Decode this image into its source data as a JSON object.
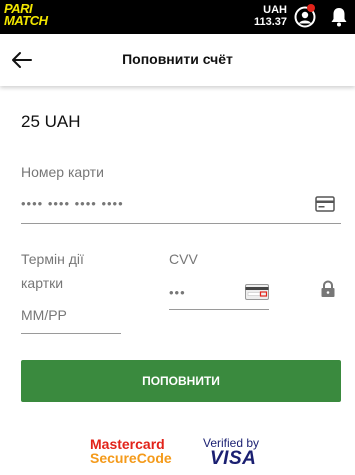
{
  "topbar": {
    "logo_line1": "PARI",
    "logo_line2": "MATCH",
    "currency": "UAH",
    "balance": "113.37"
  },
  "header": {
    "title": "Поповнити счёт"
  },
  "amount": "25 UAH",
  "form": {
    "card_label": "Номер карти",
    "card_value": "•••• •••• •••• ••••",
    "expiry_label": "Термін дії картки",
    "expiry_placeholder": "ММ/РР",
    "cvv_label": "CVV",
    "cvv_value": "•••"
  },
  "submit_label": "ПОПОВНИТИ",
  "badges": {
    "mastercard_line1": "Mastercard",
    "mastercard_line2": "SecureCode",
    "visa_line1": "Verified by",
    "visa_line2": "VISA"
  },
  "colors": {
    "accent": "#3a8a3e",
    "logo": "#f2e600",
    "topbar": "#000000",
    "notification": "#e2231a"
  },
  "icons": [
    "back-arrow-icon",
    "user-icon",
    "bell-icon",
    "card-icon",
    "cvv-card-icon",
    "lock-icon"
  ]
}
